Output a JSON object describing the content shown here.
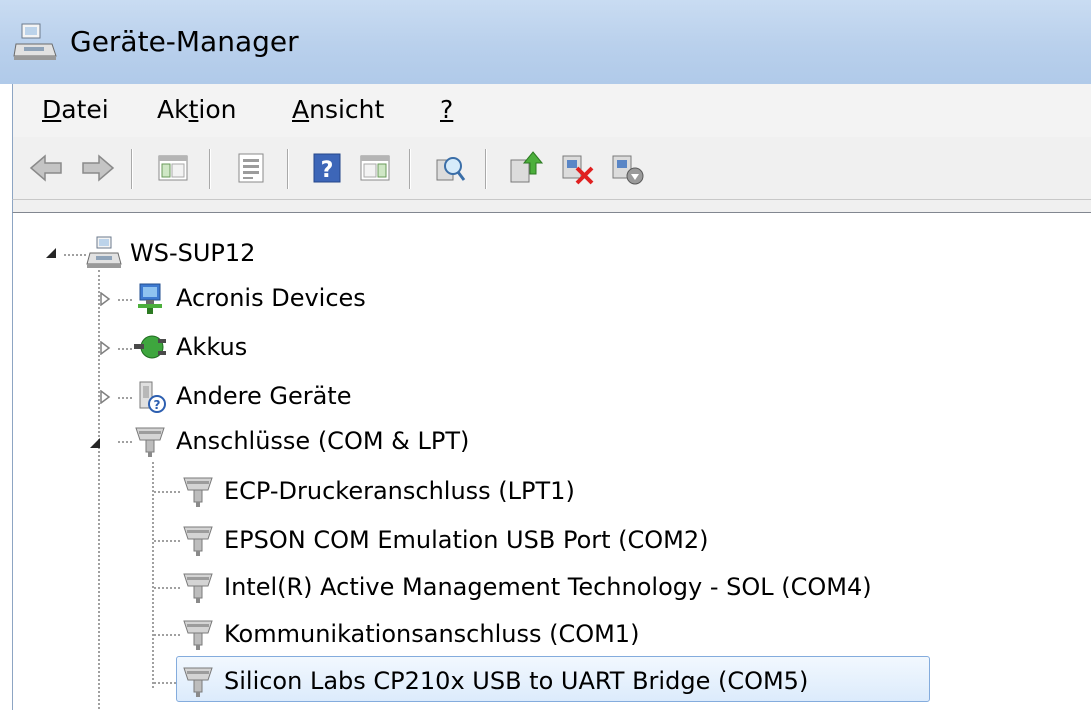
{
  "window": {
    "title": "Geräte-Manager"
  },
  "menu": [
    {
      "pre": "",
      "ul": "D",
      "post": "atei"
    },
    {
      "pre": "Ak",
      "ul": "t",
      "post": "ion"
    },
    {
      "pre": "",
      "ul": "A",
      "post": "nsicht"
    },
    {
      "pre": "",
      "ul": "?",
      "post": ""
    }
  ],
  "toolbar": [
    "back-icon",
    "forward-icon",
    "show-hide-console-tree-icon",
    "properties-icon",
    "help-icon",
    "action-pane-icon",
    "scan-hardware-icon",
    "update-driver-icon",
    "uninstall-icon",
    "disable-device-icon"
  ],
  "tree": {
    "root": "WS-SUP12",
    "categories": [
      {
        "label": "Acronis Devices"
      },
      {
        "label": "Akkus"
      },
      {
        "label": "Andere Geräte"
      },
      {
        "label": "Anschlüsse (COM & LPT)"
      }
    ],
    "ports": [
      "ECP-Druckeranschluss (LPT1)",
      "EPSON COM Emulation USB Port (COM2)",
      "Intel(R) Active Management Technology - SOL (COM4)",
      "Kommunikationsanschluss (COM1)",
      "Silicon Labs CP210x USB to UART Bridge (COM5)"
    ]
  }
}
